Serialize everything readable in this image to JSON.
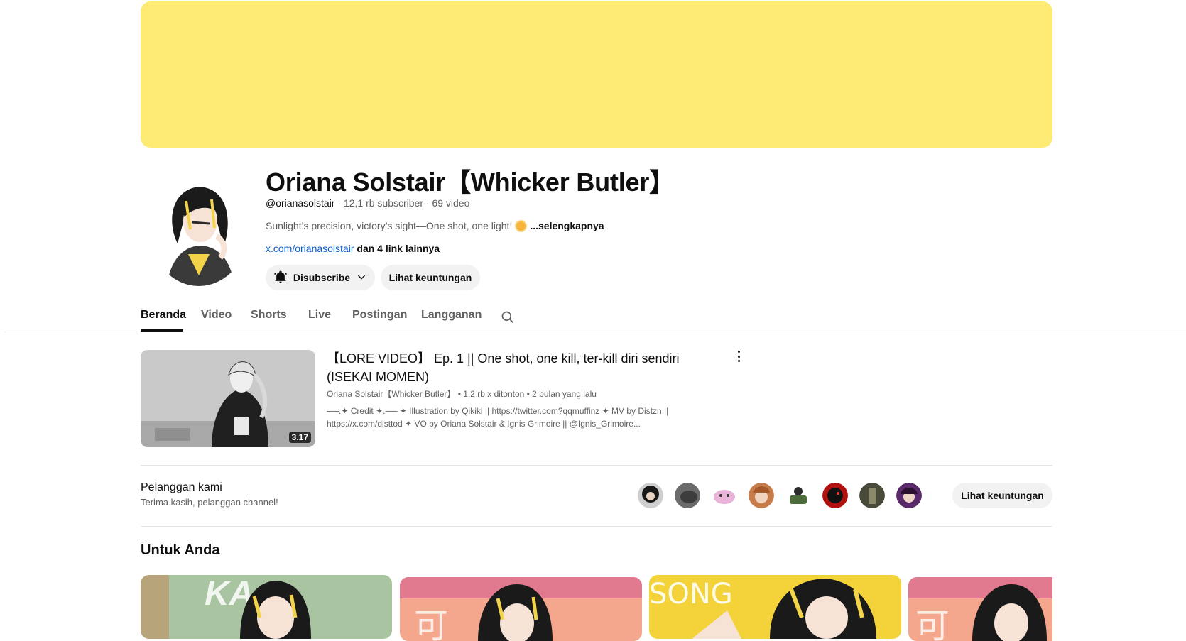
{
  "channel": {
    "name": "Oriana Solstair【Whicker Butler】",
    "handle": "@orianasolstair",
    "stats": " · 12,1 rb subscriber · 69 video",
    "description": "Sunlight’s precision, victory’s sight—One shot, one light!",
    "more_label": "...selengkapnya",
    "link": "x.com/orianasolstair",
    "link_extra": " dan 4 link lainnya",
    "subscribe_label": "Disubscribe",
    "perks_label": "Lihat keuntungan",
    "banner_color": "#feeb74"
  },
  "tabs": [
    "Beranda",
    "Video",
    "Shorts",
    "Live",
    "Postingan",
    "Langganan"
  ],
  "featured": {
    "title": "【LORE VIDEO】 Ep. 1 || One shot, one kill, ter-kill diri sendiri (ISEKAI MOMEN)",
    "meta": "Oriana Solstair【Whicker Butler】 • 1,2 rb x ditonton • 2 bulan yang lalu",
    "description": "──.✦ Credit ✦.── ✦ Illustration by Qikiki || https://twitter.com?qqmuffinz ✦ MV by Distzn || https://x.com/disttod ✦ VO by Oriana Solstair & Ignis Grimoire || @Ignis_Grimoire...",
    "duration": "3.17"
  },
  "members": {
    "title": "Pelanggan kami",
    "subtitle": "Terima kasih, pelanggan channel!",
    "button_label": "Lihat keuntungan"
  },
  "for_you": {
    "title": "Untuk Anda"
  },
  "icons": [
    "bell-icon",
    "chevron-down-icon",
    "search-icon",
    "more-vert-icon"
  ]
}
